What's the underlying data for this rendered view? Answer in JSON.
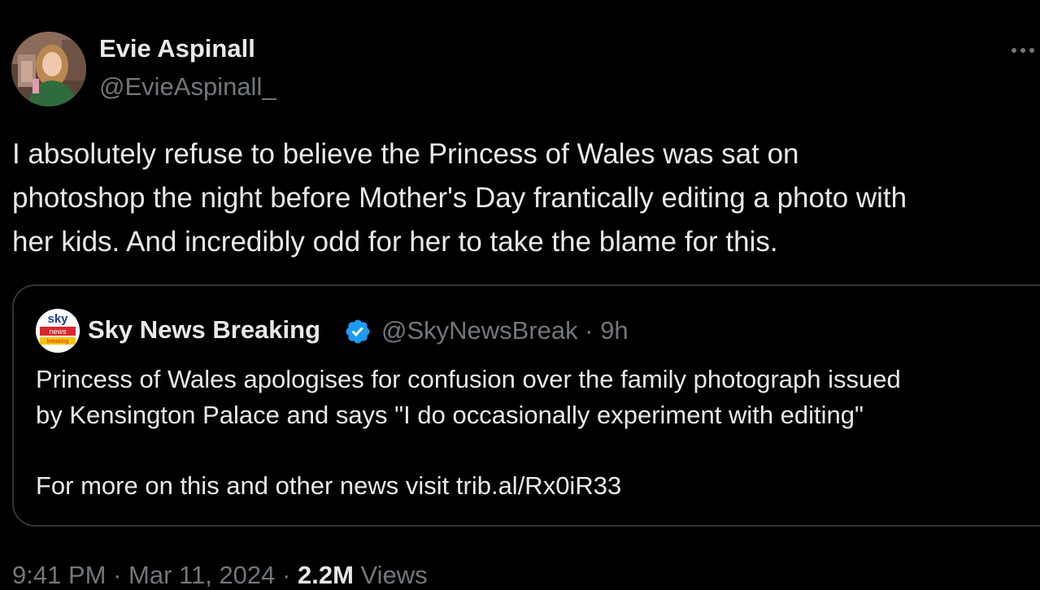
{
  "tweet": {
    "author_name": "Evie Aspinall",
    "author_handle": "@EvieAspinall_",
    "text_lines": [
      "I absolutely refuse to believe the Princess of Wales was sat on",
      "photoshop the night before Mother's Day frantically editing a photo with",
      "her kids. And incredibly odd for her to take the blame for this."
    ],
    "time": "9:41 PM",
    "separator": "·",
    "date": "Mar 11, 2024",
    "views_count": "2.2M",
    "views_label": "Views"
  },
  "quote": {
    "logo_text": {
      "top": "sky",
      "middle": "news",
      "bottom": "breaking"
    },
    "author_name": "Sky News Breaking",
    "handle_time": "@SkyNewsBreak · 9h",
    "text_lines": [
      "Princess of Wales apologises for confusion over the family photograph issued",
      "by Kensington Palace and says \"I do occasionally experiment with editing\""
    ],
    "link_line": "For more on this and other news visit trib.al/Rx0iR33"
  },
  "icons": {
    "more": "more-horizontal-icon",
    "verified": "verified-badge-icon"
  },
  "colors": {
    "background": "#000000",
    "text_primary": "#e7e9ea",
    "text_secondary": "#71767b",
    "border": "#2f3336",
    "verified_blue": "#1d9bf0",
    "sky_red": "#d7262e"
  }
}
